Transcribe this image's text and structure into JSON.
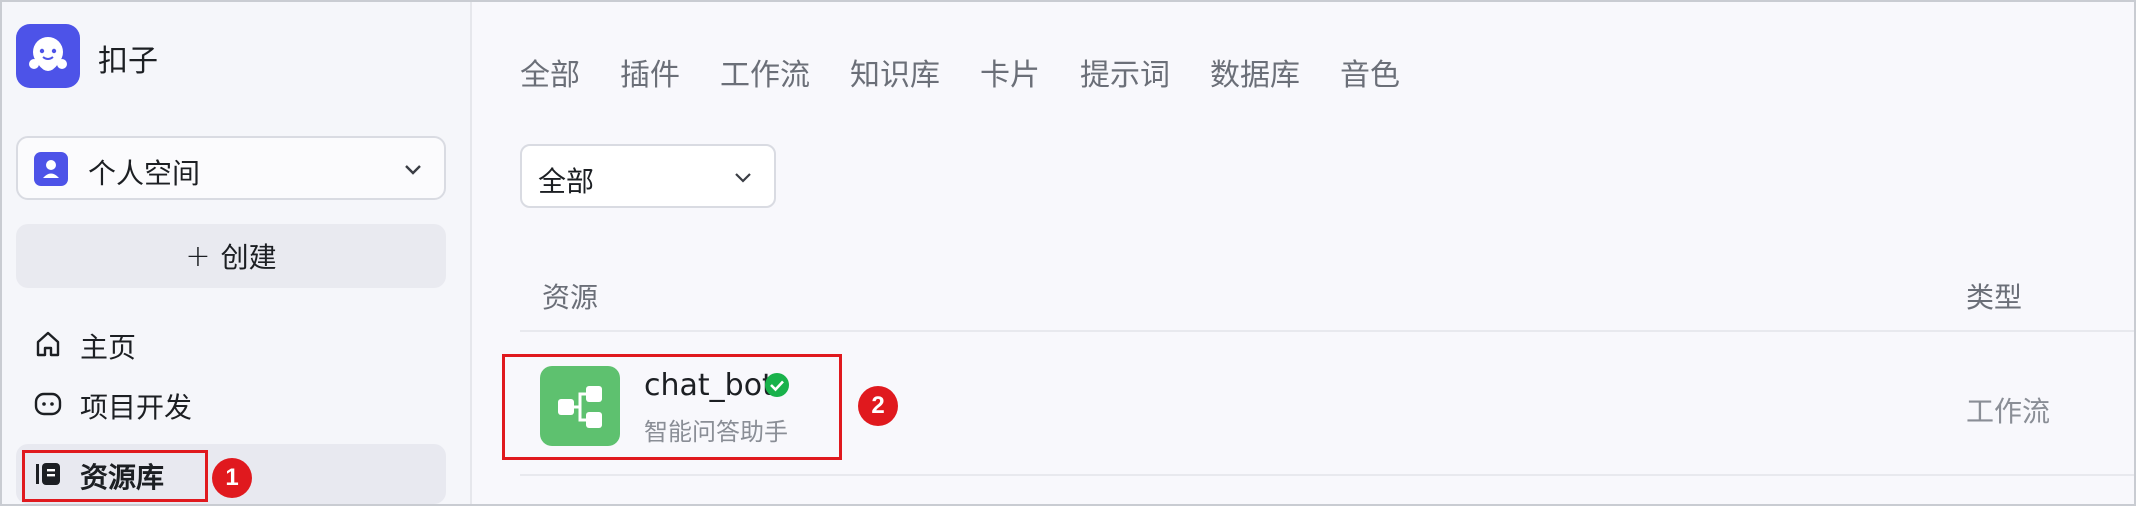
{
  "app": {
    "name": "扣子"
  },
  "sidebar": {
    "space_label": "个人空间",
    "create_label": "创建",
    "items": [
      {
        "label": "主页",
        "icon": "home-icon"
      },
      {
        "label": "项目开发",
        "icon": "project-icon"
      },
      {
        "label": "资源库",
        "icon": "library-icon",
        "active": true
      }
    ]
  },
  "main": {
    "tabs": [
      "全部",
      "插件",
      "工作流",
      "知识库",
      "卡片",
      "提示词",
      "数据库",
      "音色"
    ],
    "type_filter": "全部",
    "columns": {
      "resource": "资源",
      "type": "类型"
    },
    "rows": [
      {
        "name": "chat_bot",
        "description": "智能问答助手",
        "type": "工作流",
        "verified": true
      }
    ]
  },
  "annotations": [
    "1",
    "2"
  ],
  "colors": {
    "brand": "#4d53e8",
    "workflow_icon": "#5ec16f",
    "verified": "#19b24b",
    "annotation": "#e0191e"
  }
}
